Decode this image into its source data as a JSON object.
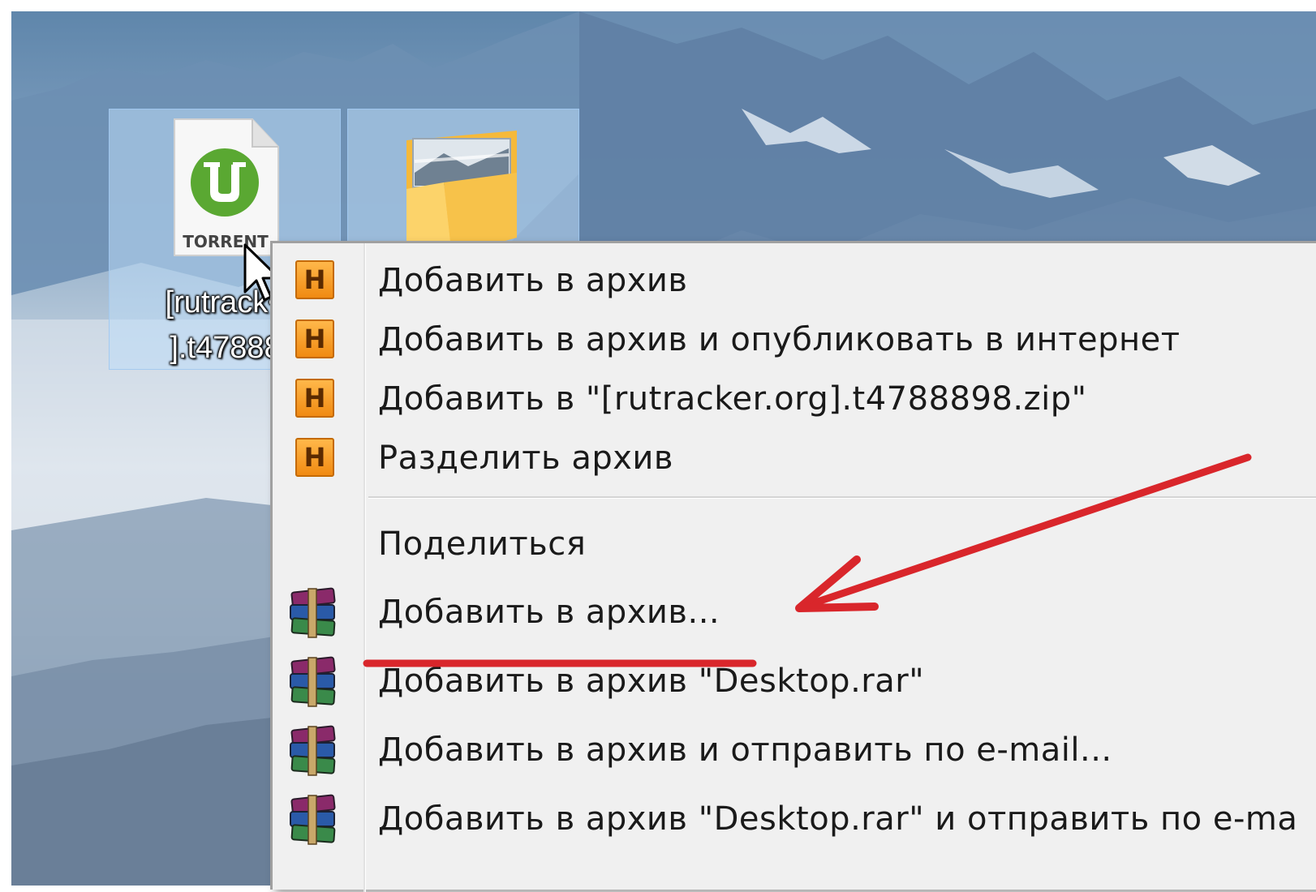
{
  "desktop": {
    "icons": [
      {
        "kind": "torrent-file",
        "badge_text": "TORRENT",
        "label": "[rutrack<\n].t47888"
      },
      {
        "kind": "folder"
      }
    ]
  },
  "context_menu": {
    "hz_icon_glyph": "H",
    "items": [
      {
        "label": "Добавить в архив",
        "icon": "hamster-archiver-icon"
      },
      {
        "label": "Добавить в архив и опубликовать в интернет",
        "icon": "hamster-archiver-icon"
      },
      {
        "label": "Добавить в \"[rutracker.org].t4788898.zip\"",
        "icon": "hamster-archiver-icon"
      },
      {
        "label": "Разделить архив",
        "icon": "hamster-archiver-icon"
      },
      {
        "label": "Поделиться",
        "icon": null
      },
      {
        "label": "Добавить в архив...",
        "icon": "winrar-icon",
        "highlighted_by_annotation": true
      },
      {
        "label": "Добавить в архив \"Desktop.rar\"",
        "icon": "winrar-icon"
      },
      {
        "label": "Добавить в архив и отправить по e-mail...",
        "icon": "winrar-icon"
      },
      {
        "label": "Добавить в архив \"Desktop.rar\" и отправить по e-ma",
        "icon": "winrar-icon"
      }
    ]
  },
  "annotation": {
    "color": "#d9262b",
    "type": "arrow-and-underline"
  },
  "colors": {
    "menu_bg": "#f0f0f0",
    "hz_orange": "#f5a02a",
    "utorrent_green": "#5aa832"
  }
}
